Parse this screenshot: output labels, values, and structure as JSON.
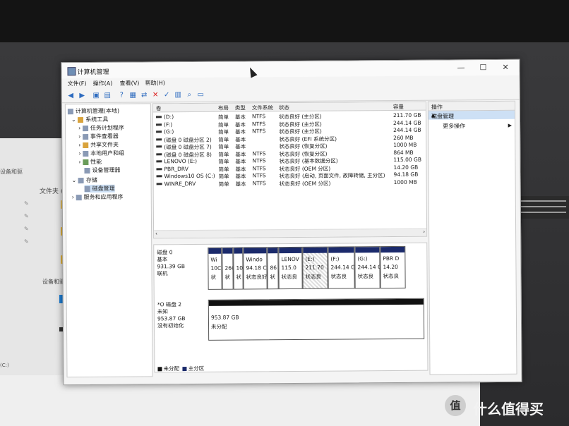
{
  "window": {
    "title": "计算机管理",
    "min": "—",
    "max": "☐",
    "close": "✕"
  },
  "menu": [
    "文件(F)",
    "操作(A)",
    "查看(V)",
    "帮助(H)"
  ],
  "tree": {
    "root": "计算机管理(本地)",
    "system_tools": "系统工具",
    "items": [
      "任务计划程序",
      "事件查看器",
      "共享文件夹",
      "本地用户和组",
      "性能",
      "设备管理器"
    ],
    "storage": "存储",
    "disk_mgmt": "磁盘管理",
    "services": "服务和应用程序"
  },
  "list": {
    "headers": [
      "卷",
      "布局",
      "类型",
      "文件系统",
      "状态",
      "容量"
    ],
    "rows": [
      {
        "vol": "(D:)",
        "layout": "简单",
        "type": "基本",
        "fs": "NTFS",
        "status": "状态良好 (主分区)",
        "cap": "211.70 GB"
      },
      {
        "vol": "(F:)",
        "layout": "简单",
        "type": "基本",
        "fs": "NTFS",
        "status": "状态良好 (主分区)",
        "cap": "244.14 GB"
      },
      {
        "vol": "(G:)",
        "layout": "简单",
        "type": "基本",
        "fs": "NTFS",
        "status": "状态良好 (主分区)",
        "cap": "244.14 GB"
      },
      {
        "vol": "(磁盘 0 磁盘分区 2)",
        "layout": "简单",
        "type": "基本",
        "fs": "",
        "status": "状态良好 (EFI 系统分区)",
        "cap": "260 MB"
      },
      {
        "vol": "(磁盘 0 磁盘分区 7)",
        "layout": "简单",
        "type": "基本",
        "fs": "",
        "status": "状态良好 (恢复分区)",
        "cap": "1000 MB"
      },
      {
        "vol": "(磁盘 0 磁盘分区 8)",
        "layout": "简单",
        "type": "基本",
        "fs": "NTFS",
        "status": "状态良好 (恢复分区)",
        "cap": "864 MB"
      },
      {
        "vol": "LENOVO (E:)",
        "layout": "简单",
        "type": "基本",
        "fs": "NTFS",
        "status": "状态良好 (基本数据分区)",
        "cap": "115.00 GB"
      },
      {
        "vol": "PBR_DRV",
        "layout": "简单",
        "type": "基本",
        "fs": "NTFS",
        "status": "状态良好 (OEM 分区)",
        "cap": "14.20 GB"
      },
      {
        "vol": "Windows10 OS (C:)",
        "layout": "简单",
        "type": "基本",
        "fs": "NTFS",
        "status": "状态良好 (启动, 页面文件, 故障转储, 主分区)",
        "cap": "94.18 GB"
      },
      {
        "vol": "WINRE_DRV",
        "layout": "简单",
        "type": "基本",
        "fs": "NTFS",
        "status": "状态良好 (OEM 分区)",
        "cap": "1000 MB"
      }
    ]
  },
  "disk0": {
    "name": "磁盘 0",
    "type": "基本",
    "size": "931.39 GB",
    "status": "联机",
    "parts": [
      {
        "title": "Wi",
        "size": "10C",
        "st": "状"
      },
      {
        "title": "",
        "size": "26C",
        "st": "状"
      },
      {
        "title": "",
        "size": "10",
        "st": "状"
      },
      {
        "title": "Windo",
        "size": "94.18 C",
        "st": "状态良好"
      },
      {
        "title": "",
        "size": "86",
        "st": "状"
      },
      {
        "title": "LENOV",
        "size": "115.0",
        "st": "状态良"
      },
      {
        "title": "(E:)",
        "size": "211.70",
        "st": "状态良"
      },
      {
        "title": "(F:)",
        "size": "244.14 G",
        "st": "状态良"
      },
      {
        "title": "(G:)",
        "size": "244.14 G",
        "st": "状态良"
      },
      {
        "title": "PBR D",
        "size": "14.20",
        "st": "状态良"
      }
    ]
  },
  "disk2": {
    "name": "*O 磁盘 2",
    "type": "未知",
    "size": "953.87 GB",
    "status": "没有初始化",
    "part_size": "953.87 GB",
    "part_label": "未分配"
  },
  "legend": [
    "未分配",
    "主分区"
  ],
  "actions": {
    "header": "操作",
    "selected": "磁盘管理",
    "more": "更多操作"
  },
  "bg": {
    "crumb": "设备和驱",
    "quick_access": "文件夹 (6",
    "devices": "设备和驱",
    "scroll": "(C:)"
  },
  "watermark": {
    "icon": "值",
    "text": "什么值得买"
  }
}
